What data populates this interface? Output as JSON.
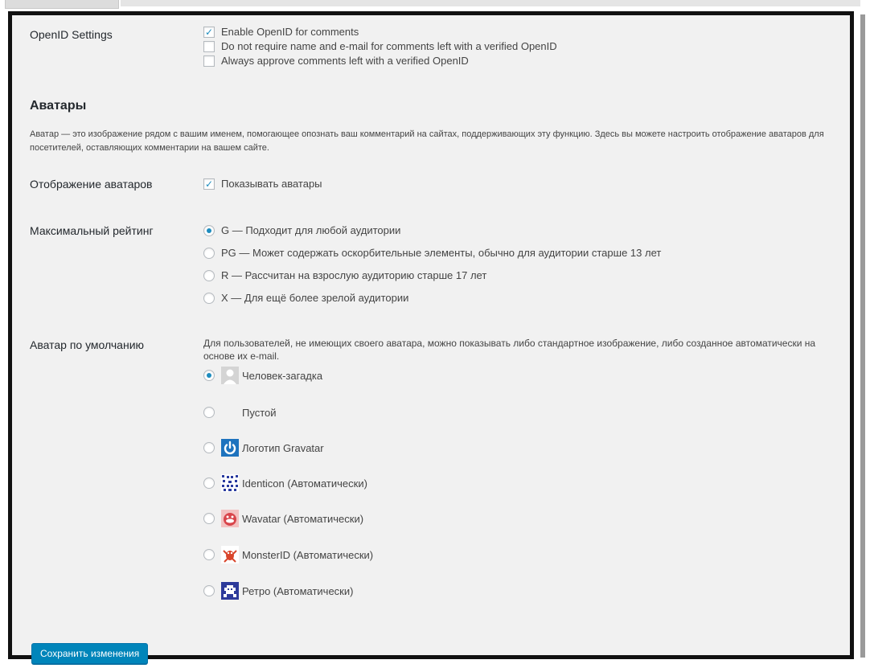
{
  "openid": {
    "label": "OpenID Settings",
    "options": [
      {
        "label": "Enable OpenID for comments",
        "checked": true
      },
      {
        "label": "Do not require name and e-mail for comments left with a verified OpenID",
        "checked": false
      },
      {
        "label": "Always approve comments left with a verified OpenID",
        "checked": false
      }
    ]
  },
  "avatars": {
    "title": "Аватары",
    "description": "Аватар — это изображение рядом с вашим именем, помогающее опознать ваш комментарий на сайтах, поддерживающих эту функцию. Здесь вы можете настроить отображение аватаров для посетителей, оставляющих комментарии на вашем сайте.",
    "display": {
      "label": "Отображение аватаров",
      "checkbox_label": "Показывать аватары",
      "checked": true
    },
    "rating": {
      "label": "Максимальный рейтинг",
      "selected": "G",
      "options": [
        {
          "value": "G",
          "label": "G — Подходит для любой аудитории"
        },
        {
          "value": "PG",
          "label": "PG — Может содержать оскорбительные элементы, обычно для аудитории старше 13 лет"
        },
        {
          "value": "R",
          "label": "R — Рассчитан на взрослую аудиторию старше 17 лет"
        },
        {
          "value": "X",
          "label": "X — Для ещё более зрелой аудитории"
        }
      ]
    },
    "default": {
      "label": "Аватар по умолчанию",
      "description": "Для пользователей, не имеющих своего аватара, можно показывать либо стандартное изображение, либо созданное автоматически на основе их e-mail.",
      "selected": "mystery",
      "options": [
        {
          "value": "mystery",
          "label": "Человек-загадка",
          "icon": "mystery-person-icon"
        },
        {
          "value": "blank",
          "label": "Пустой",
          "icon": "blank-icon"
        },
        {
          "value": "gravatar",
          "label": "Логотип Gravatar",
          "icon": "gravatar-logo-icon"
        },
        {
          "value": "identicon",
          "label": "Identicon (Автоматически)",
          "icon": "identicon-icon"
        },
        {
          "value": "wavatar",
          "label": "Wavatar (Автоматически)",
          "icon": "wavatar-icon"
        },
        {
          "value": "monsterid",
          "label": "MonsterID (Автоматически)",
          "icon": "monsterid-icon"
        },
        {
          "value": "retro",
          "label": "Ретро (Автоматически)",
          "icon": "retro-icon"
        }
      ]
    }
  },
  "save_button": "Сохранить изменения",
  "colors": {
    "accent": "#1e8cbe",
    "button": "#0085ba",
    "background": "#f1f1f1",
    "gravatar": "#1e73be"
  }
}
